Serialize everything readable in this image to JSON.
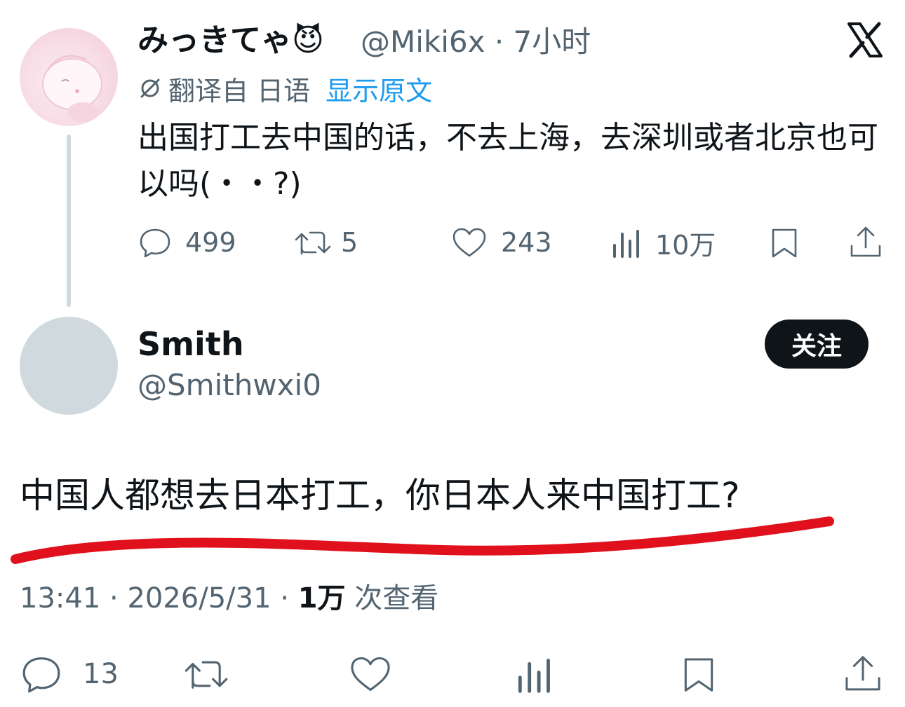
{
  "reply_to": {
    "author_name": "みっきてゃ",
    "author_emoji": "😈",
    "author_handle": "@Miki6x",
    "time_ago": "7小时",
    "translated_from": "翻译自 日语",
    "show_original": "显示原文",
    "text": "出国打工去中国的话，不去上海，去深圳或者北京也可以吗(・・?)",
    "metrics": {
      "replies": "499",
      "reposts": "5",
      "likes": "243",
      "views": "10万"
    }
  },
  "tweet": {
    "author_name": "Smith",
    "author_handle": "@Smithwxi0",
    "follow_label": "关注",
    "text": "中国人都想去日本打工，你日本人来中国打工?",
    "time": "13:41",
    "date": "2026/5/31",
    "views_count": "1万",
    "views_label": "次查看",
    "metrics": {
      "replies": "13"
    }
  },
  "annotation": {
    "underline_color": "#e0101c"
  },
  "icons": [
    "x-logo-icon",
    "translate-icon",
    "reply-icon",
    "repost-icon",
    "like-icon",
    "views-icon",
    "bookmark-icon",
    "share-icon"
  ]
}
